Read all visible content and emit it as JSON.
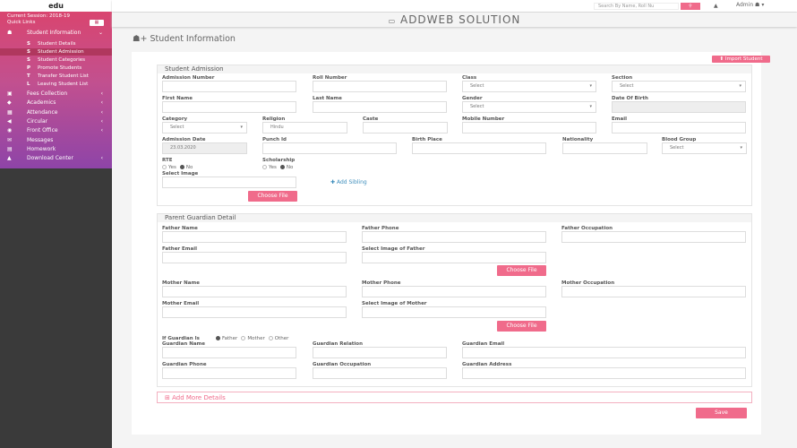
{
  "sidebar": {
    "logo": "edu",
    "session": "Current Session: 2018-19",
    "quick_links": "Quick Links",
    "main": {
      "label": "Student Information",
      "icon": "user-group"
    },
    "subitems": [
      {
        "ic": "S",
        "label": "Student Details"
      },
      {
        "ic": "S",
        "label": "Student Admission"
      },
      {
        "ic": "S",
        "label": "Student Categories"
      },
      {
        "ic": "P",
        "label": "Promote Students"
      },
      {
        "ic": "T",
        "label": "Transfer Student List"
      },
      {
        "ic": "L",
        "label": "Leaving Student List"
      }
    ],
    "items": [
      {
        "label": "Fees Collection",
        "icon": "money",
        "ic": "▣",
        "chev": "‹"
      },
      {
        "label": "Academics",
        "icon": "graduation-cap",
        "ic": "◆",
        "chev": "‹"
      },
      {
        "label": "Attendance",
        "icon": "calendar",
        "ic": "▦",
        "chev": "‹"
      },
      {
        "label": "Circular",
        "icon": "bullhorn",
        "ic": "◀",
        "chev": "‹"
      },
      {
        "label": "Front Office",
        "icon": "eye",
        "ic": "◉",
        "chev": "‹"
      },
      {
        "label": "Messages",
        "icon": "chat",
        "ic": "✉",
        "chev": ""
      },
      {
        "label": "Homework",
        "icon": "file",
        "ic": "▤",
        "chev": ""
      },
      {
        "label": "Download Center",
        "icon": "download",
        "ic": "▲",
        "chev": "‹"
      }
    ]
  },
  "topbar": {
    "search_placeholder": "Search By Name, Roll Nu",
    "user": "Admin"
  },
  "header": {
    "title": "ADDWEB SOLUTION"
  },
  "page": {
    "title": "Student Information",
    "import_label": "Import Student",
    "choose_file": "Choose File",
    "add_sibling": "Add Sibling",
    "add_more": "Add More Details",
    "save": "Save"
  },
  "admission": {
    "title": "Student Admission",
    "fields": [
      {
        "label": "Admission Number",
        "value": ""
      },
      {
        "label": "Roll Number",
        "value": ""
      },
      {
        "label": "Class",
        "value": "Select",
        "select": true
      },
      {
        "label": "Section",
        "value": "Select",
        "select": true
      },
      {
        "label": "First Name",
        "value": ""
      },
      {
        "label": "Last Name",
        "value": ""
      },
      {
        "label": "Gender",
        "value": "Select",
        "select": true
      },
      {
        "label": "Date Of Birth",
        "value": "",
        "disabled": true
      },
      {
        "label": "Category",
        "value": "Select",
        "select": true
      },
      {
        "label": "Religion",
        "value": "Hindu"
      },
      {
        "label": "Caste",
        "value": ""
      },
      {
        "label": "Mobile Number",
        "value": ""
      },
      {
        "label": "Email",
        "value": ""
      },
      {
        "label": "Admission Date",
        "value": "23.03.2020",
        "disabled": true
      },
      {
        "label": "Punch Id",
        "value": ""
      },
      {
        "label": "Birth Place",
        "value": ""
      },
      {
        "label": "Nationality",
        "value": ""
      },
      {
        "label": "Blood Group",
        "value": "Select",
        "select": true
      },
      {
        "label": "Select Image",
        "value": ""
      }
    ],
    "rte": {
      "label": "RTE",
      "options": [
        "Yes",
        "No"
      ],
      "selected": "No"
    },
    "scholarship": {
      "label": "Scholarship",
      "options": [
        "Yes",
        "No"
      ],
      "selected": "No"
    }
  },
  "parent": {
    "title": "Parent Guardian Detail",
    "fields": [
      {
        "label": "Father Name",
        "value": ""
      },
      {
        "label": "Father Phone",
        "value": ""
      },
      {
        "label": "Father Occupation",
        "value": ""
      },
      {
        "label": "Father Email",
        "value": ""
      },
      {
        "label": "Select Image of Father",
        "value": ""
      },
      {
        "label": "Mother Name",
        "value": ""
      },
      {
        "label": "Mother Phone",
        "value": ""
      },
      {
        "label": "Mother Occupation",
        "value": ""
      },
      {
        "label": "Mother Email",
        "value": ""
      },
      {
        "label": "Select Image of Mother",
        "value": ""
      },
      {
        "label": "Guardian Name",
        "value": ""
      },
      {
        "label": "Guardian Relation",
        "value": ""
      },
      {
        "label": "Guardian Email",
        "value": ""
      },
      {
        "label": "Guardian Phone",
        "value": ""
      },
      {
        "label": "Guardian Occupation",
        "value": ""
      },
      {
        "label": "Guardian Address",
        "value": ""
      }
    ],
    "guardian_is": {
      "label": "If Guardian Is",
      "options": [
        "Father",
        "Mother",
        "Other"
      ],
      "selected": "Father"
    }
  },
  "colors": {
    "accent": "#f06b8b",
    "sidebar_top": "#d9456f",
    "sidebar_bottom": "#8e44a8"
  }
}
